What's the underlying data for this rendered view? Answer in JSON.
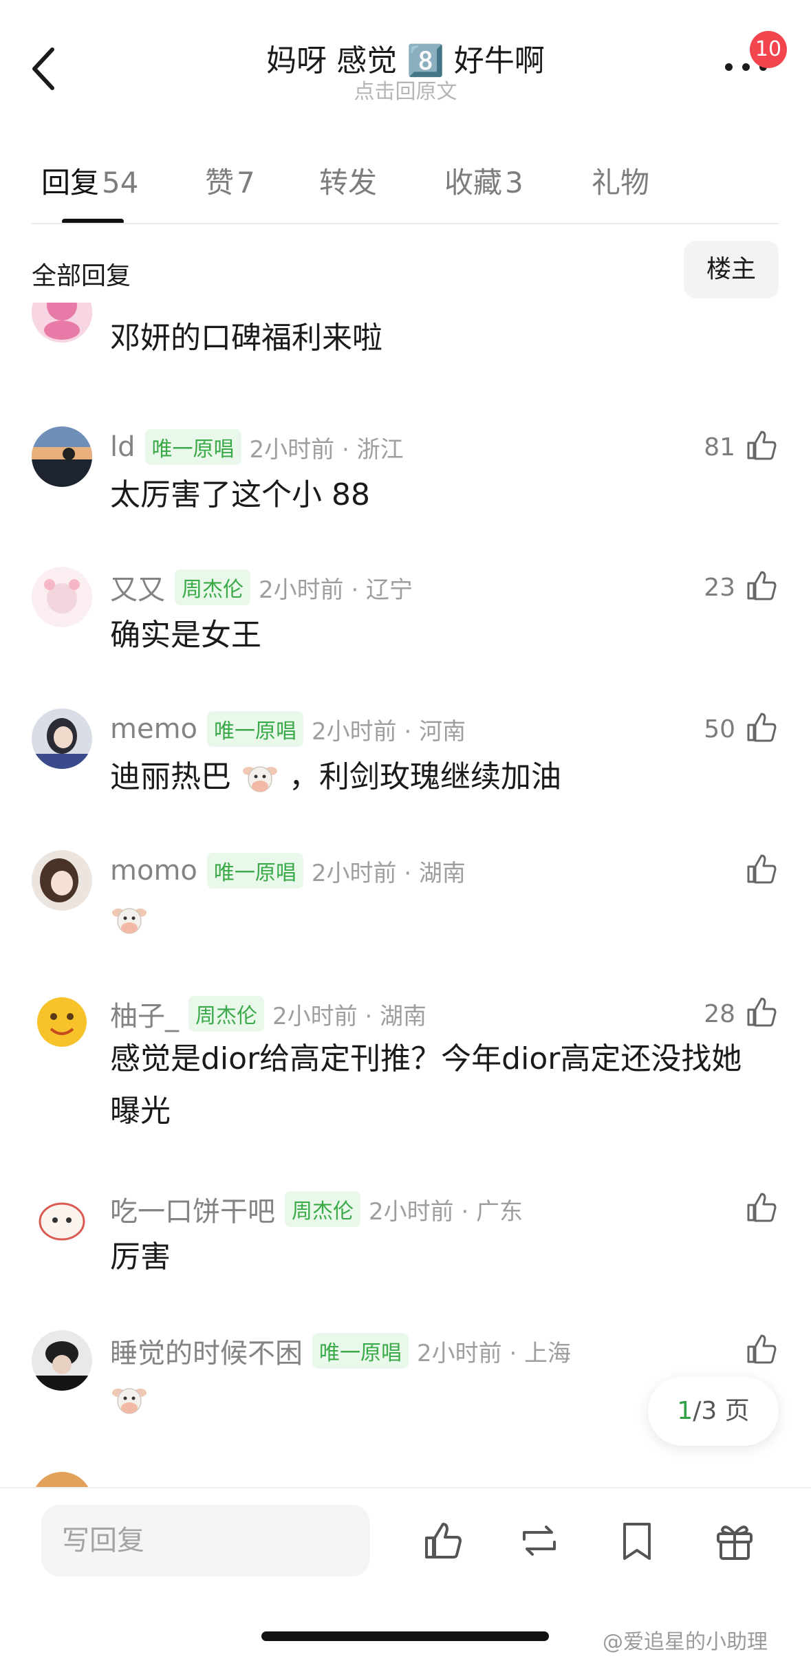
{
  "header": {
    "title": "妈呀 感觉 8️⃣ 好牛啊",
    "subtitle": "点击回原文",
    "badge": "10"
  },
  "tabs": [
    {
      "label": "回复",
      "count": "54"
    },
    {
      "label": "赞",
      "count": "7"
    },
    {
      "label": "转发",
      "count": ""
    },
    {
      "label": "收藏",
      "count": "3"
    },
    {
      "label": "礼物",
      "count": ""
    }
  ],
  "filter": {
    "label": "全部回复",
    "op_button": "楼主"
  },
  "comments": [
    {
      "user": "",
      "tag": "",
      "time": "",
      "likes": "",
      "text": "邓妍的口碑福利来啦"
    },
    {
      "user": "ld",
      "tag": "唯一原唱",
      "time": "2小时前 · 浙江",
      "likes": "81",
      "text": "太厉害了这个小 88"
    },
    {
      "user": "又又",
      "tag": "周杰伦",
      "time": "2小时前 · 辽宁",
      "likes": "23",
      "text": "确实是女王"
    },
    {
      "user": "memo",
      "tag": "唯一原唱",
      "time": "2小时前 · 河南",
      "likes": "50",
      "text_a": "迪丽热巴",
      "text_b": "，利剑玫瑰继续加油"
    },
    {
      "user": "momo",
      "tag": "唯一原唱",
      "time": "2小时前 · 湖南",
      "likes": "",
      "text": ""
    },
    {
      "user": "柚子_",
      "tag": "周杰伦",
      "time": "2小时前 · 湖南",
      "likes": "28",
      "text": "感觉是dior给高定刊推？今年dior高定还没找她曝光"
    },
    {
      "user": "吃一口饼干吧",
      "tag": "周杰伦",
      "time": "2小时前 · 广东",
      "likes": "",
      "text": "厉害"
    },
    {
      "user": "睡觉的时候不困",
      "tag": "唯一原唱",
      "time": "2小时前 · 上海",
      "likes": "",
      "text": ""
    }
  ],
  "pager": {
    "current": "1",
    "total": "/3 页"
  },
  "bottom": {
    "reply_placeholder": "写回复"
  },
  "watermark": "@爱追星的小助理",
  "colors": {
    "accent_green": "#3aaa48",
    "badge_red": "#f2454d",
    "tag_bg": "#eaf8ec"
  }
}
